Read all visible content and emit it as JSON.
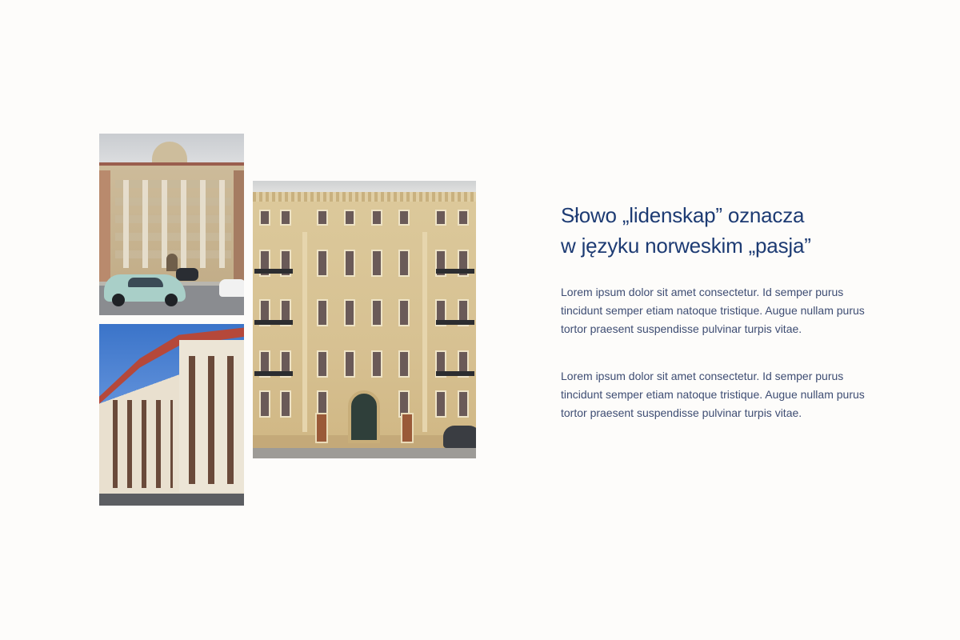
{
  "gallery": {
    "photos": [
      {
        "id": "photo-tenement-with-car"
      },
      {
        "id": "photo-corner-building"
      },
      {
        "id": "photo-main-facade"
      }
    ]
  },
  "content": {
    "headline_line1": "Słowo „lidenskap” oznacza",
    "headline_line2": "w języku norweskim „pasja”",
    "paragraphs": [
      "Lorem ipsum dolor sit amet consectetur. Id semper purus tincidunt semper etiam natoque tristique. Augue nullam purus tortor praesent suspendisse pulvinar turpis vitae.",
      "Lorem ipsum dolor sit amet consectetur. Id semper purus tincidunt semper etiam natoque tristique. Augue nullam purus tortor praesent suspendisse pulvinar turpis vitae."
    ]
  },
  "colors": {
    "background": "#fdfcfa",
    "headline": "#1d3b73",
    "body_text": "#3e4d73"
  }
}
